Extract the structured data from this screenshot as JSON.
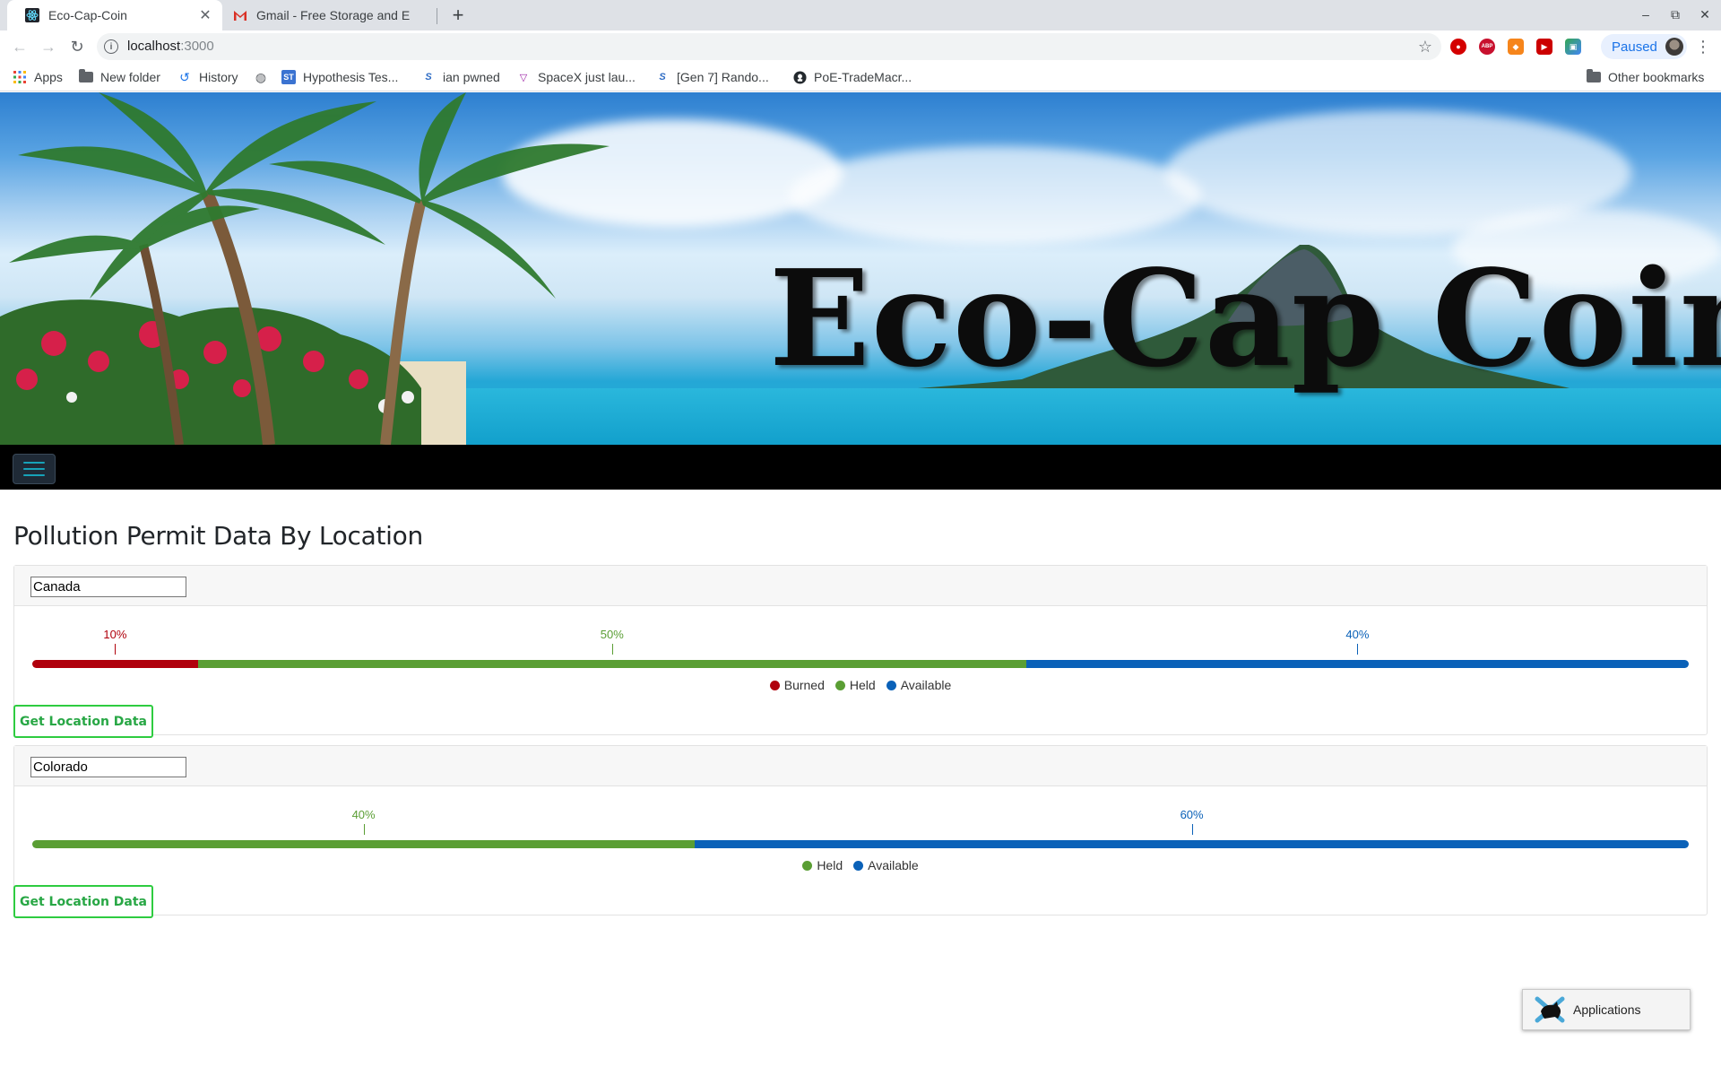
{
  "browser": {
    "tabs": [
      {
        "title": "Eco-Cap-Coin",
        "icon": "react-icon",
        "active": true
      },
      {
        "title": "Gmail - Free Storage and E",
        "icon": "gmail-icon",
        "active": false
      }
    ],
    "address": {
      "host": "localhost",
      "port": ":3000"
    },
    "profile_status": "Paused",
    "bookmarks": [
      {
        "label": "Apps",
        "icon": "apps-grid-icon"
      },
      {
        "label": "New folder",
        "icon": "folder-icon"
      },
      {
        "label": "History",
        "icon": "history-icon"
      },
      {
        "label": "",
        "icon": "globe-icon"
      },
      {
        "label": "Hypothesis Tes...",
        "icon": "st-icon"
      },
      {
        "label": "ian pwned",
        "icon": "s-icon"
      },
      {
        "label": "SpaceX just lau...",
        "icon": "verge-icon"
      },
      {
        "label": "[Gen 7] Rando...",
        "icon": "s-icon"
      },
      {
        "label": "PoE-TradeMacr...",
        "icon": "github-icon"
      }
    ],
    "other_bookmarks": "Other bookmarks"
  },
  "hero": {
    "title": "Eco-Cap Coin"
  },
  "page": {
    "heading": "Pollution Permit Data By Location",
    "button_label": "Get Location Data",
    "colors": {
      "burned": "#b0000c",
      "held": "#5a9e34",
      "available": "#0a61b8"
    },
    "locations": [
      {
        "name": "Canada",
        "segments": [
          {
            "label": "Burned",
            "percent": 10,
            "percent_text": "10%"
          },
          {
            "label": "Held",
            "percent": 50,
            "percent_text": "50%"
          },
          {
            "label": "Available",
            "percent": 40,
            "percent_text": "40%"
          }
        ]
      },
      {
        "name": "Colorado",
        "segments": [
          {
            "label": "Held",
            "percent": 40,
            "percent_text": "40%"
          },
          {
            "label": "Available",
            "percent": 60,
            "percent_text": "60%"
          }
        ]
      }
    ]
  },
  "taskbar": {
    "applications_label": "Applications"
  }
}
